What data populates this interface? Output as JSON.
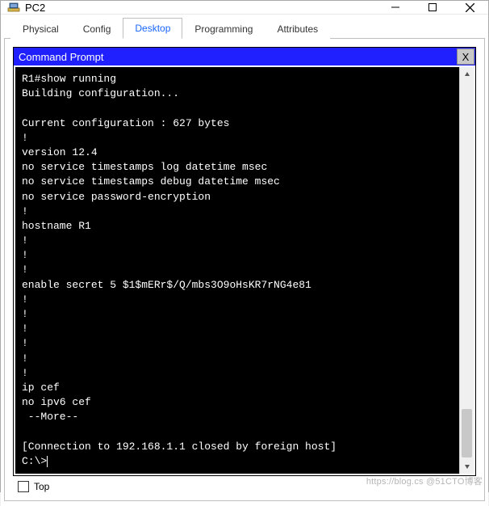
{
  "window": {
    "title": "PC2",
    "colors": {
      "accent": "#2020ff"
    }
  },
  "tabs": [
    {
      "label": "Physical",
      "active": false
    },
    {
      "label": "Config",
      "active": false
    },
    {
      "label": "Desktop",
      "active": true
    },
    {
      "label": "Programming",
      "active": false
    },
    {
      "label": "Attributes",
      "active": false
    }
  ],
  "prompt": {
    "title": "Command Prompt",
    "close_label": "X",
    "lines": [
      "R1#show running",
      "Building configuration...",
      "",
      "Current configuration : 627 bytes",
      "!",
      "version 12.4",
      "no service timestamps log datetime msec",
      "no service timestamps debug datetime msec",
      "no service password-encryption",
      "!",
      "hostname R1",
      "!",
      "!",
      "!",
      "enable secret 5 $1$mERr$/Q/mbs3O9oHsKR7rNG4e81",
      "!",
      "!",
      "!",
      "!",
      "!",
      "!",
      "ip cef",
      "no ipv6 cef",
      " --More--",
      "",
      "[Connection to 192.168.1.1 closed by foreign host]",
      "C:\\>"
    ]
  },
  "footer": {
    "top_label": "Top",
    "top_checked": false
  },
  "watermark": "https://blog.cs  @51CTO博客"
}
